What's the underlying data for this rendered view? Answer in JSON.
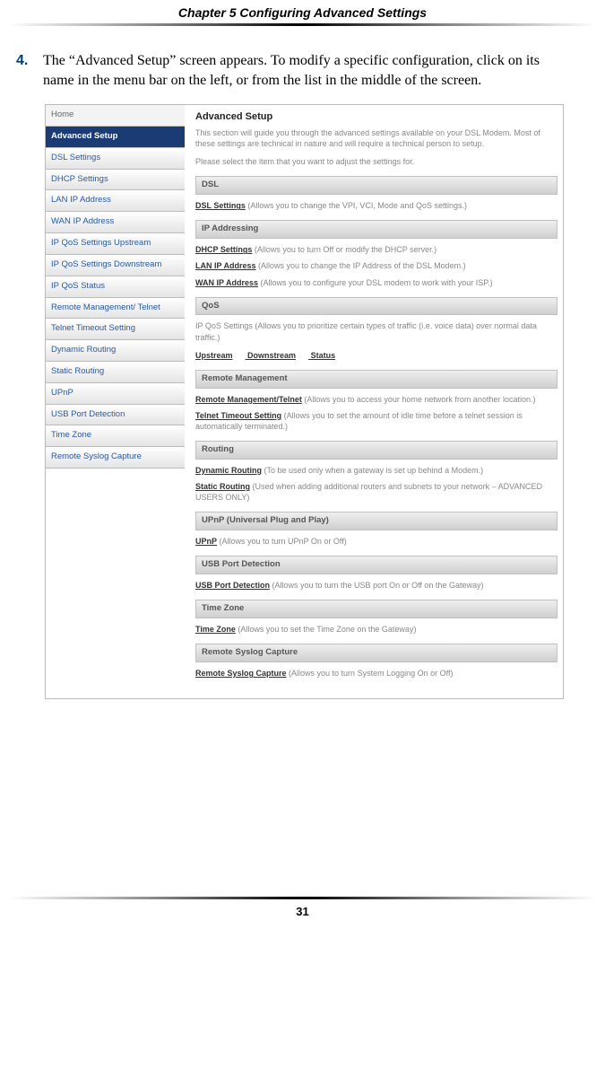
{
  "header": {
    "chapter": "Chapter 5 ",
    "title": "Configuring Advanced Settings"
  },
  "step": {
    "number": "4.",
    "text": "The “Advanced Setup” screen appears. To modify a specific configuration, click on its name in the menu bar on the left, or from the list in the middle of the screen."
  },
  "sidebar": {
    "items": [
      "Home",
      "Advanced Setup",
      "DSL Settings",
      "DHCP Settings",
      "LAN IP Address",
      "WAN IP Address",
      "IP QoS Settings Upstream",
      "IP QoS Settings Downstream",
      "IP QoS Status",
      "Remote Management/ Telnet",
      "Telnet Timeout Setting",
      "Dynamic Routing",
      "Static Routing",
      "UPnP",
      "USB Port Detection",
      "Time Zone",
      "Remote Syslog Capture"
    ]
  },
  "main": {
    "title": "Advanced Setup",
    "intro1": "This section will guide you through the advanced settings available on your DSL Modem. Most of these settings are technical in nature and will require a technical person to setup.",
    "intro2": "Please select the item that you want to adjust the settings for.",
    "sections": {
      "dsl": {
        "head": "DSL",
        "link": "DSL Settings",
        "desc": " (Allows you to change the VPI, VCI, Mode and QoS settings.)"
      },
      "ip": {
        "head": "IP Addressing",
        "dhcp_link": "DHCP Settings",
        "dhcp_desc": " (Allows you to turn Off or modify the DHCP server.)",
        "lan_link": "LAN IP Address",
        "lan_desc": " (Allows you to change the IP Address of the DSL Modem.)",
        "wan_link": "WAN IP Address",
        "wan_desc": " (Allows you to configure your DSL modem to work with your ISP.)"
      },
      "qos": {
        "head": "QoS",
        "desc": "IP QoS Settings (Allows you to prioritize certain types of traffic (i.e. voice data) over normal data traffic.)",
        "l1": "Upstream",
        "l2": "Downstream",
        "l3": "Status"
      },
      "remote": {
        "head": "Remote Management",
        "rm_link": "Remote Management/Telnet",
        "rm_desc": " (Allows you to access your home network from another location.)",
        "tt_link": "Telnet Timeout Setting",
        "tt_desc": " (Allows you to set the amount of idle time before a telnet session is automatically terminated.)"
      },
      "routing": {
        "head": "Routing",
        "dyn_link": "Dynamic Routing",
        "dyn_desc": " (To be used only when a gateway is set up behind a Modem.)",
        "stat_link": "Static Routing",
        "stat_desc": " (Used when adding additional routers and subnets to your network – ADVANCED USERS ONLY)"
      },
      "upnp": {
        "head": "UPnP (Universal Plug and Play)",
        "link": "UPnP",
        "desc": " (Allows you to turn UPnP On or Off)"
      },
      "usb": {
        "head": "USB Port Detection",
        "link": "USB Port Detection",
        "desc": " (Allows you to turn the USB port On or Off on the Gateway)"
      },
      "tz": {
        "head": "Time Zone",
        "link": "Time Zone",
        "desc": " (Allows you to set the Time Zone on the Gateway)"
      },
      "syslog": {
        "head": "Remote Syslog Capture",
        "link": "Remote Syslog Capture",
        "desc": " (Allows you to turn System Logging On or Off)"
      }
    }
  },
  "page_number": "31"
}
